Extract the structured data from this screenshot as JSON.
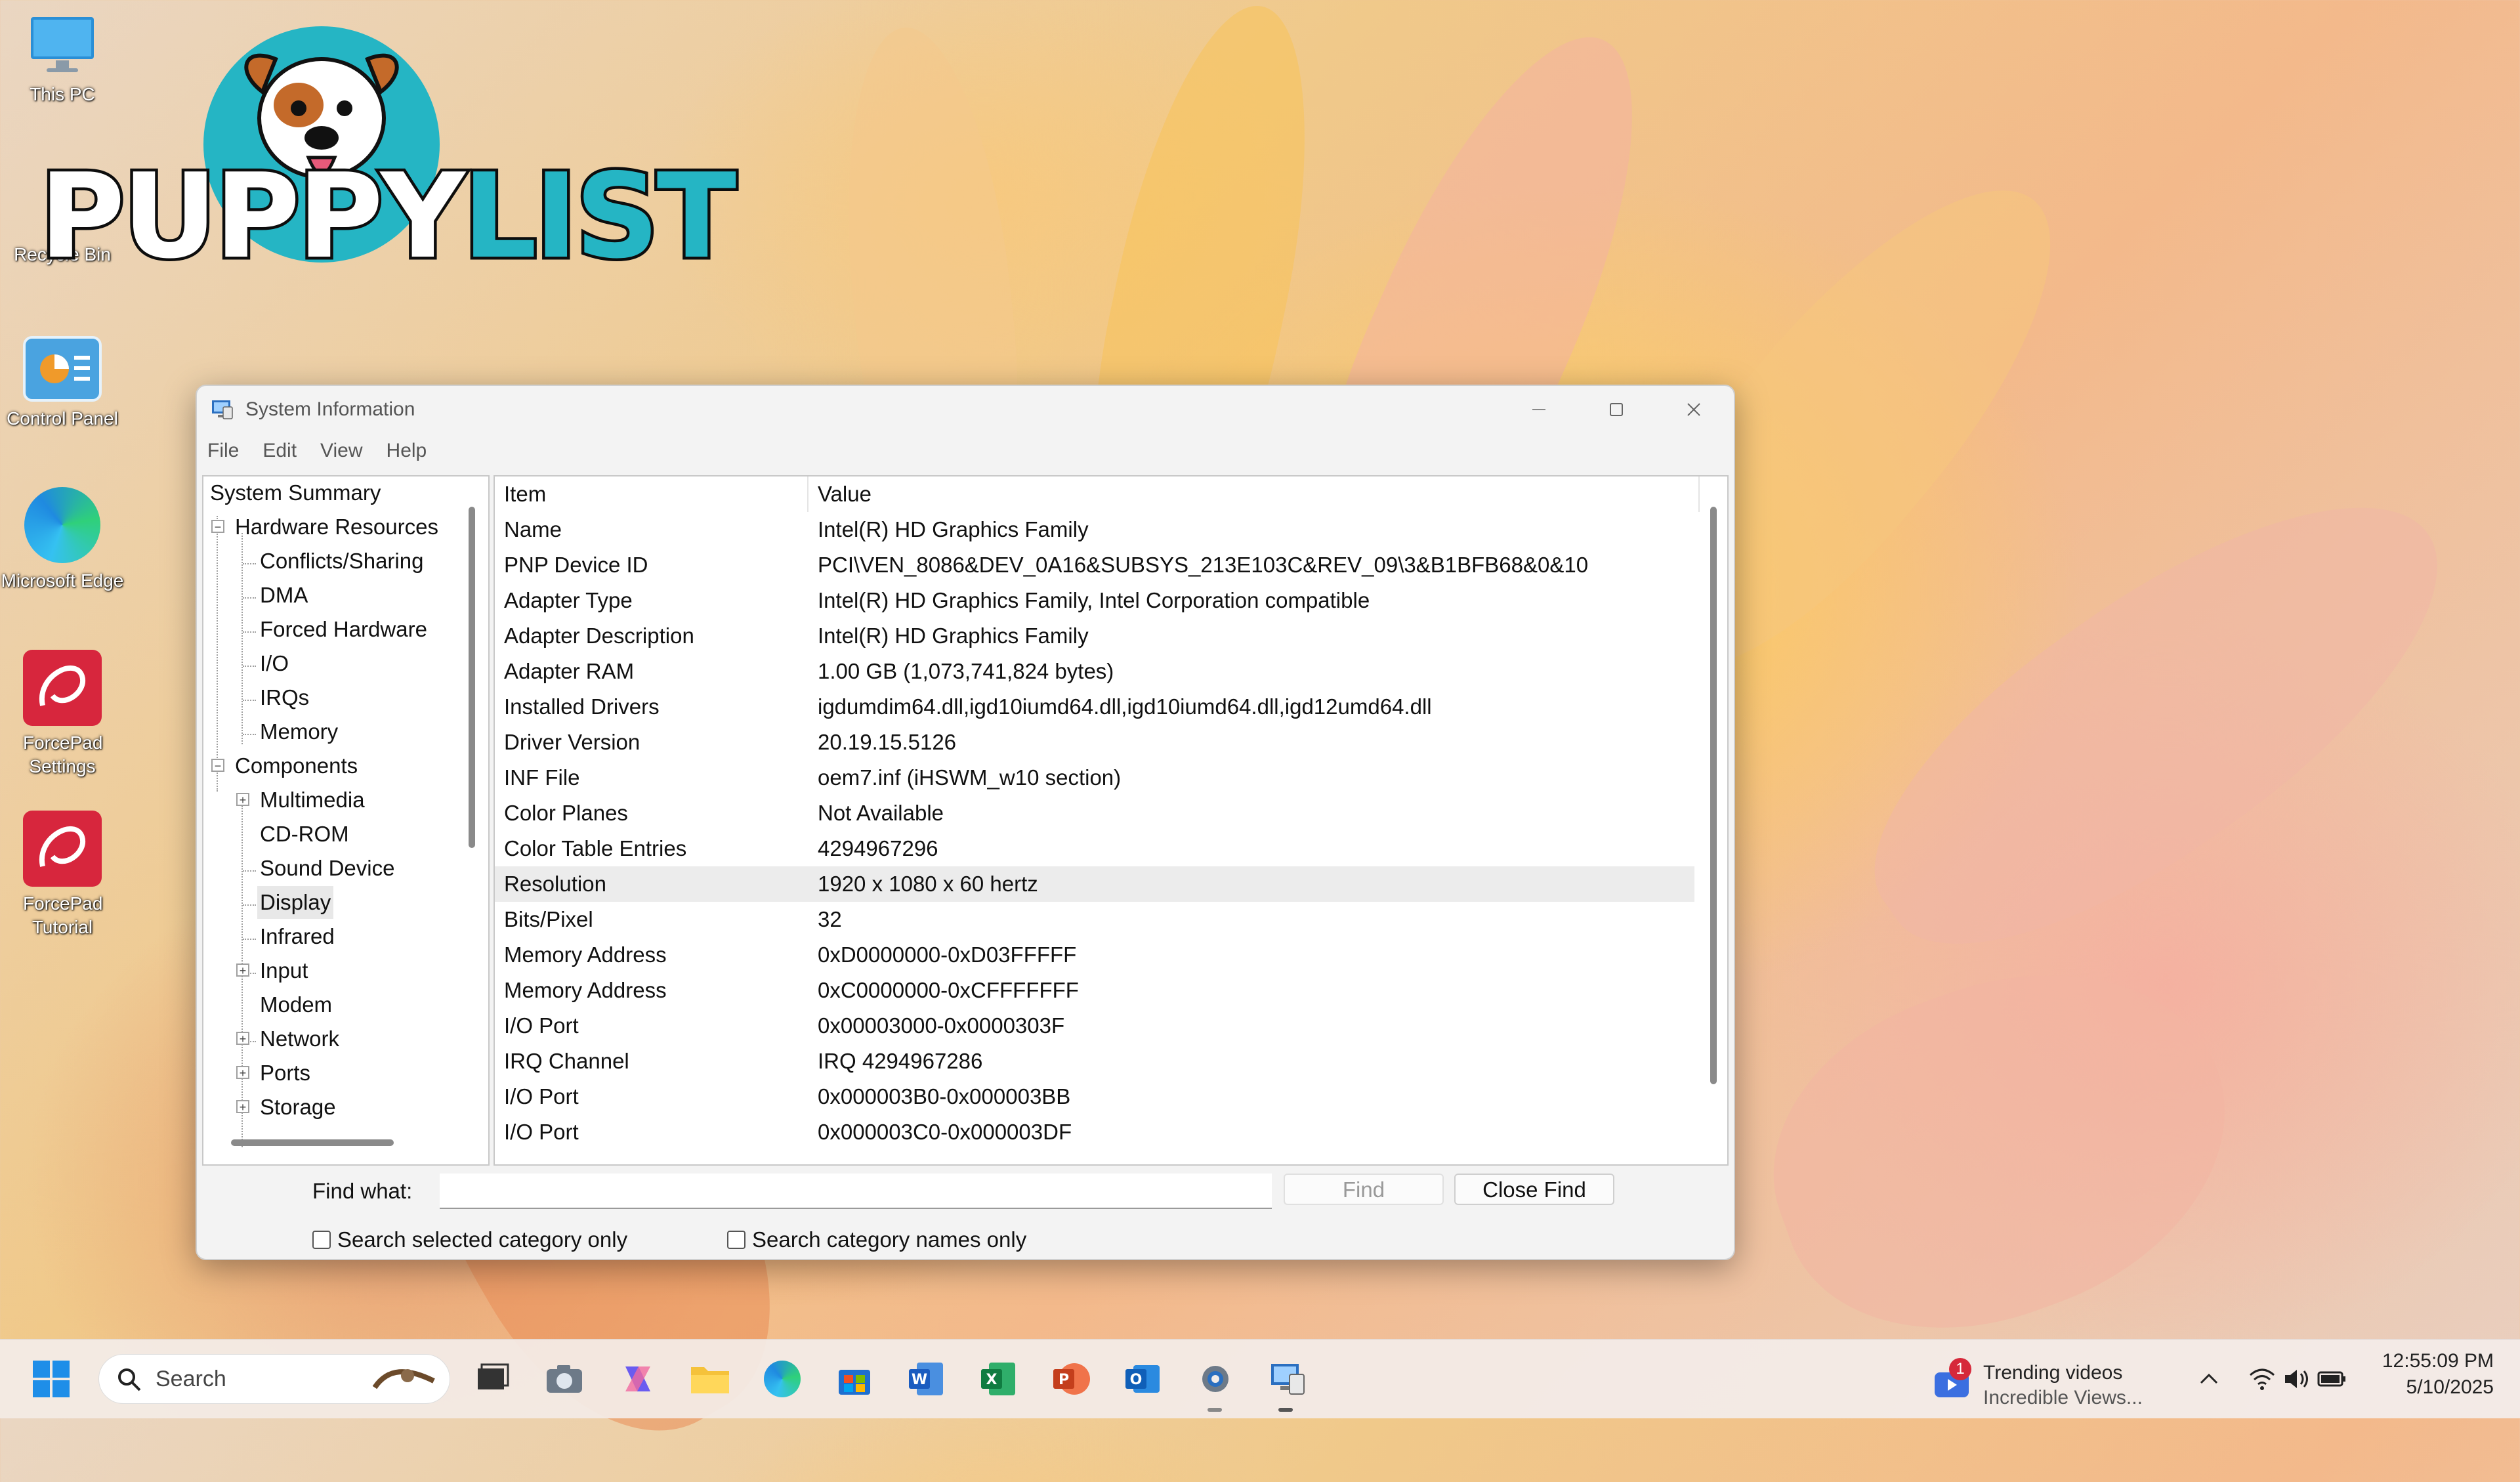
{
  "desktop": {
    "icons": [
      {
        "label": "This PC"
      },
      {
        "label": "Recycle Bin"
      },
      {
        "label": "Control Panel"
      },
      {
        "label": "Microsoft Edge"
      },
      {
        "label": "ForcePad Settings"
      },
      {
        "label": "ForcePad Tutorial"
      }
    ],
    "logo": {
      "part1": "PUPPY",
      "part2": "LIST"
    }
  },
  "window": {
    "title": "System Information",
    "menu": [
      "File",
      "Edit",
      "View",
      "Help"
    ],
    "tree": {
      "root": "System Summary",
      "hardware": {
        "label": "Hardware Resources",
        "children": [
          "Conflicts/Sharing",
          "DMA",
          "Forced Hardware",
          "I/O",
          "IRQs",
          "Memory"
        ]
      },
      "components": {
        "label": "Components",
        "children": [
          "Multimedia",
          "CD-ROM",
          "Sound Device",
          "Display",
          "Infrared",
          "Input",
          "Modem",
          "Network",
          "Ports",
          "Storage"
        ]
      }
    },
    "grid": {
      "headers": {
        "item": "Item",
        "value": "Value"
      },
      "rows": [
        {
          "item": "Name",
          "value": "Intel(R) HD Graphics Family"
        },
        {
          "item": "PNP Device ID",
          "value": "PCI\\VEN_8086&DEV_0A16&SUBSYS_213E103C&REV_09\\3&B1BFB68&0&10"
        },
        {
          "item": "Adapter Type",
          "value": "Intel(R) HD Graphics Family, Intel Corporation compatible"
        },
        {
          "item": "Adapter Description",
          "value": "Intel(R) HD Graphics Family"
        },
        {
          "item": "Adapter RAM",
          "value": "1.00 GB (1,073,741,824 bytes)"
        },
        {
          "item": "Installed Drivers",
          "value": "igdumdim64.dll,igd10iumd64.dll,igd10iumd64.dll,igd12umd64.dll"
        },
        {
          "item": "Driver Version",
          "value": "20.19.15.5126"
        },
        {
          "item": "INF File",
          "value": "oem7.inf (iHSWM_w10 section)"
        },
        {
          "item": "Color Planes",
          "value": "Not Available"
        },
        {
          "item": "Color Table Entries",
          "value": "4294967296"
        },
        {
          "item": "Resolution",
          "value": "1920 x 1080 x 60 hertz"
        },
        {
          "item": "Bits/Pixel",
          "value": "32"
        },
        {
          "item": "Memory Address",
          "value": "0xD0000000-0xD03FFFFF"
        },
        {
          "item": "Memory Address",
          "value": "0xC0000000-0xCFFFFFFF"
        },
        {
          "item": "I/O Port",
          "value": "0x00003000-0x0000303F"
        },
        {
          "item": "IRQ Channel",
          "value": "IRQ 4294967286"
        },
        {
          "item": "I/O Port",
          "value": "0x000003B0-0x000003BB"
        },
        {
          "item": "I/O Port",
          "value": "0x000003C0-0x000003DF"
        }
      ]
    },
    "find": {
      "label": "Find what:",
      "value": "",
      "find_button": "Find",
      "close_button": "Close Find",
      "check1": "Search selected category only",
      "check2": "Search category names only"
    }
  },
  "taskbar": {
    "search_placeholder": "Search",
    "widget_title": "Trending videos",
    "widget_sub": "Incredible Views...",
    "widget_badge": "1",
    "time": "12:55:09 PM",
    "date": "5/10/2025"
  },
  "colors": {
    "accent": "#0067c0",
    "logo_teal": "#25b5c4"
  }
}
